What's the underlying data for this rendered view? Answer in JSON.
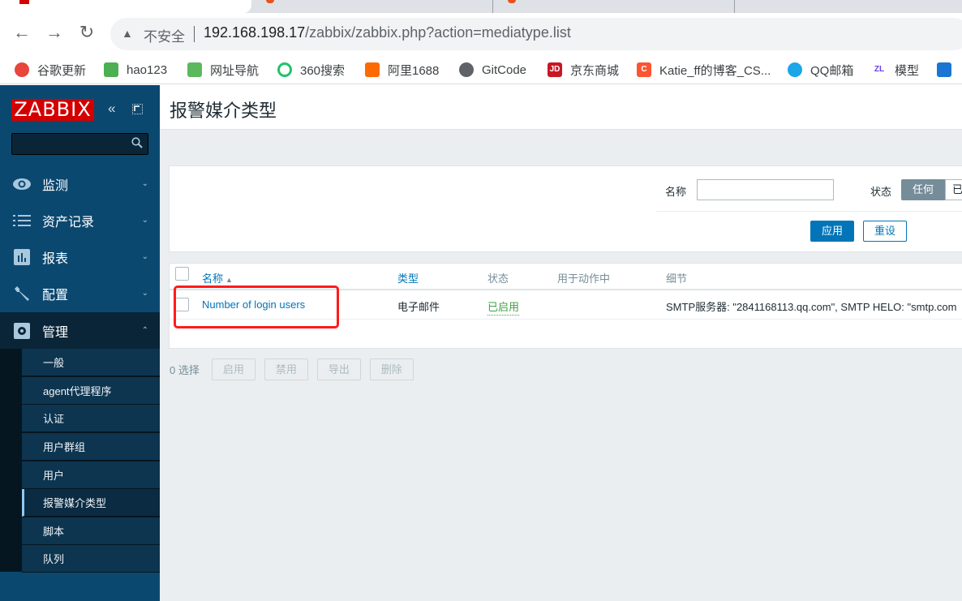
{
  "browser": {
    "address": {
      "security_label": "不安全",
      "url_host": "192.168.198.17",
      "url_rest": "/zabbix/zabbix.php?action=mediatype.list"
    },
    "bookmarks": [
      {
        "label": "谷歌更新",
        "icon": "chrome-icon",
        "color": "#e8453c"
      },
      {
        "label": "hao123",
        "icon": "hao123-icon",
        "color": "#4caf50"
      },
      {
        "label": "网址导航",
        "icon": "2345-icon",
        "color": "#5cb85c"
      },
      {
        "label": "360搜索",
        "icon": "360-search-icon",
        "color": "#f5a623"
      },
      {
        "label": "阿里1688",
        "icon": "alibaba-icon",
        "color": "#ff6a00"
      },
      {
        "label": "GitCode",
        "icon": "globe-icon",
        "color": "#5f6368"
      },
      {
        "label": "京东商城",
        "icon": "jd-icon",
        "color": "#c91623"
      },
      {
        "label": "Katie_ff的博客_CS...",
        "icon": "csdn-icon",
        "color": "#fc5531"
      },
      {
        "label": "QQ邮箱",
        "icon": "qq-mail-icon",
        "color": "#1aa6e8"
      },
      {
        "label": "模型",
        "icon": "zl-icon",
        "color": "#6a3de8"
      },
      {
        "label": "",
        "icon": "remote-desktop-icon",
        "color": "#1976d2"
      }
    ]
  },
  "sidebar": {
    "logo": "ZABBIX",
    "search_placeholder": "",
    "menu": [
      {
        "label": "监测",
        "icon": "eye-icon",
        "expanded": false
      },
      {
        "label": "资产记录",
        "icon": "list-icon",
        "expanded": false
      },
      {
        "label": "报表",
        "icon": "bar-chart-icon",
        "expanded": false
      },
      {
        "label": "配置",
        "icon": "wrench-icon",
        "expanded": false
      },
      {
        "label": "管理",
        "icon": "gear-icon",
        "expanded": true
      }
    ],
    "submenu": [
      {
        "label": "一般"
      },
      {
        "label": "agent代理程序"
      },
      {
        "label": "认证"
      },
      {
        "label": "用户群组"
      },
      {
        "label": "用户"
      },
      {
        "label": "报警媒介类型",
        "active": true
      },
      {
        "label": "脚本"
      },
      {
        "label": "队列"
      }
    ]
  },
  "page": {
    "title": "报警媒介类型"
  },
  "filter": {
    "name_label": "名称",
    "name_value": "",
    "status_label": "状态",
    "status_options": [
      "任何",
      "已"
    ],
    "status_selected": "任何",
    "apply_label": "应用",
    "reset_label": "重设"
  },
  "table": {
    "columns": [
      {
        "label": "名称",
        "sortable": true,
        "sort": "asc"
      },
      {
        "label": "类型",
        "sortable": true
      },
      {
        "label": "状态",
        "sortable": false
      },
      {
        "label": "用于动作中",
        "sortable": false
      },
      {
        "label": "细节",
        "sortable": false
      }
    ],
    "sort_indicator": "▲",
    "rows": [
      {
        "name": "Number of login users",
        "type": "电子邮件",
        "status": "已启用",
        "used_in_actions": "",
        "details": "SMTP服务器: \"2841168113.qq.com\", SMTP HELO: \"smtp.com"
      }
    ]
  },
  "actions": {
    "selected_count": "0 选择",
    "buttons": [
      "启用",
      "禁用",
      "导出",
      "删除"
    ]
  },
  "colors": {
    "sidebar_bg": "#0b4870",
    "logo_bg": "#d40000",
    "link": "#0275b8",
    "status_enabled": "#429e47",
    "highlight_box": "#ff1a1a"
  }
}
